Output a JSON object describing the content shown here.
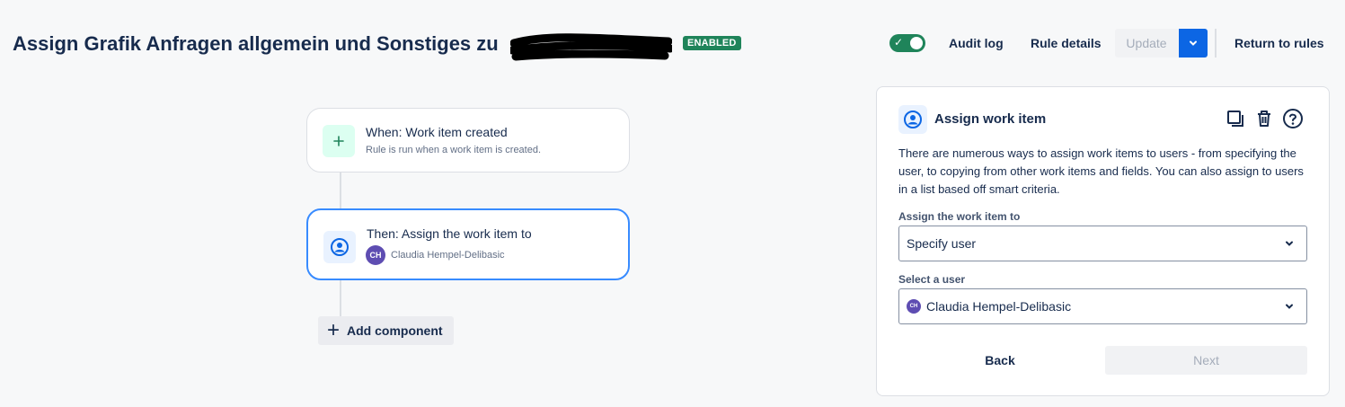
{
  "header": {
    "title": "Assign Grafik Anfragen allgemein und Sonstiges zu",
    "status_badge": "ENABLED",
    "audit_log": "Audit log",
    "rule_details": "Rule details",
    "update": "Update",
    "return_to_rules": "Return to rules",
    "toggle_on": true
  },
  "flow": {
    "trigger": {
      "title": "When: Work item created",
      "subtitle": "Rule is run when a work item is created."
    },
    "action": {
      "title": "Then: Assign the work item to",
      "user_initials": "CH",
      "user_name": "Claudia Hempel-Delibasic"
    },
    "add_component": "Add component"
  },
  "panel": {
    "title": "Assign work item",
    "description": "There are numerous ways to assign work items to users - from specifying the user, to copying from other work items and fields. You can also assign to users in a list based off smart criteria.",
    "assign_label": "Assign the work item to",
    "assign_value": "Specify user",
    "user_label": "Select a user",
    "user_initials": "CH",
    "user_value": "Claudia Hempel-Delibasic",
    "back": "Back",
    "next": "Next"
  },
  "colors": {
    "accent": "#0c66e4",
    "success": "#1f845a",
    "selected_border": "#388bff",
    "avatar": "#5e4db2"
  }
}
